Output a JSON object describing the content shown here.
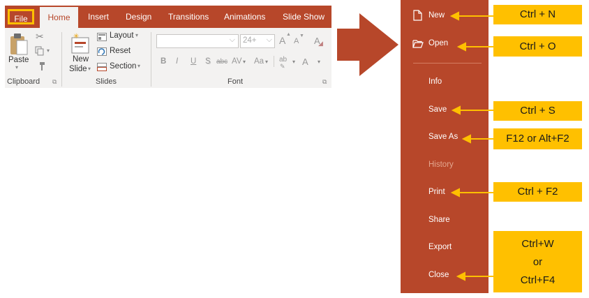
{
  "ribbon": {
    "tabs": {
      "file": "File",
      "home": "Home",
      "insert": "Insert",
      "design": "Design",
      "transitions": "Transitions",
      "animations": "Animations",
      "slideshow": "Slide Show"
    },
    "clipboard": {
      "paste_label": "Paste",
      "group_label": "Clipboard"
    },
    "slides": {
      "new_slide_line1": "New",
      "new_slide_line2": "Slide",
      "layout_label": "Layout",
      "reset_label": "Reset",
      "section_label": "Section",
      "group_label": "Slides"
    },
    "font": {
      "font_size": "24+",
      "bold": "B",
      "italic": "I",
      "underline": "U",
      "shadow": "S",
      "strikethrough": "abc",
      "spacing": "AV",
      "change_case": "Aa",
      "highlight": "ab",
      "font_color": "A",
      "grow": "A",
      "shrink": "A",
      "clear": "A",
      "group_label": "Font"
    }
  },
  "backstage": {
    "items": {
      "new": "New",
      "open": "Open",
      "info": "Info",
      "save": "Save",
      "save_as": "Save As",
      "history": "History",
      "print": "Print",
      "share": "Share",
      "export": "Export",
      "close": "Close"
    }
  },
  "shortcuts": {
    "new": "Ctrl + N",
    "open": "Ctrl + O",
    "save": "Ctrl + S",
    "save_as": "F12 or Alt+F2",
    "print": "Ctrl + F2",
    "close_line1": "Ctrl+W",
    "close_line2": "or",
    "close_line3": "Ctrl+F4"
  },
  "colors": {
    "accent": "#b7472a",
    "highlight": "#ffc000",
    "ribbon_bg": "#f3f2f1"
  }
}
